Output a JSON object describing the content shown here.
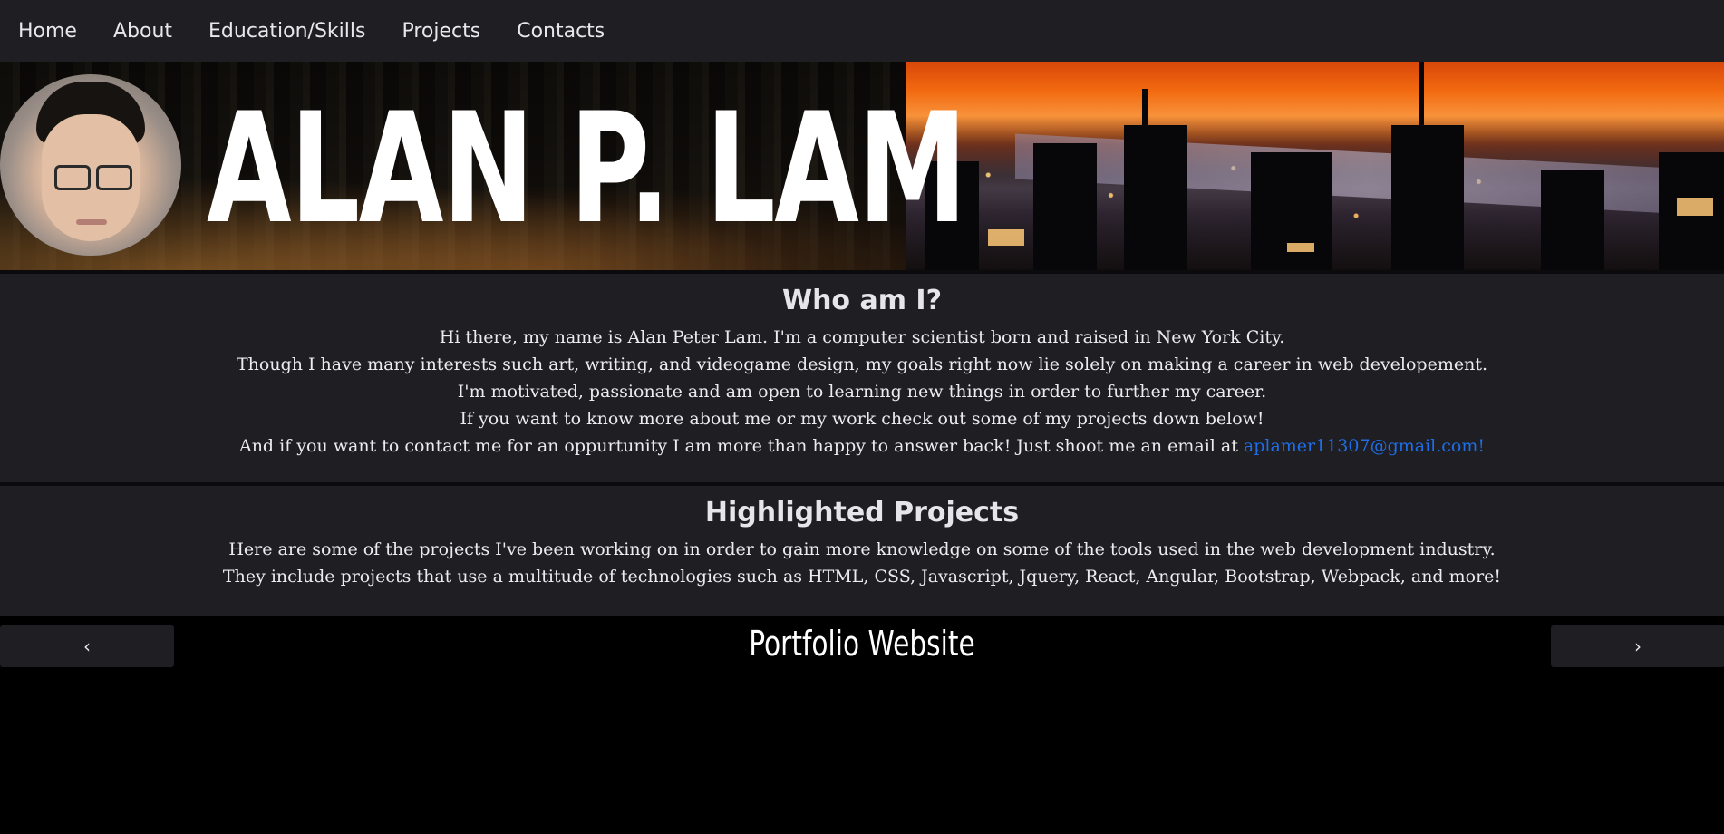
{
  "nav": {
    "items": [
      {
        "label": "Home"
      },
      {
        "label": "About"
      },
      {
        "label": "Education/Skills"
      },
      {
        "label": "Projects"
      },
      {
        "label": "Contacts"
      }
    ]
  },
  "banner": {
    "name": "ALAN P. LAM"
  },
  "about": {
    "title": "Who am I?",
    "lines": [
      "Hi there, my name is Alan Peter Lam. I'm a computer scientist born and raised in New York City.",
      "Though I have many interests such art, writing, and videogame design, my goals right now lie solely on making a career in web developement.",
      "I'm motivated, passionate and am open to learning new things in order to further my career.",
      "If you want to know more about me or my work check out some of my projects down below!",
      "And if you want to contact me for an oppurtunity I am more than happy to answer back! Just shoot me an email at "
    ],
    "email": "aplamer11307@gmail.com!"
  },
  "projects": {
    "title": "Highlighted Projects",
    "lines": [
      "Here are some of the projects I've been working on in order to gain more knowledge on some of the tools used in the web development industry.",
      "They include projects that use a multitude of technologies such as HTML, CSS, Javascript, Jquery, React, Angular, Bootstrap, Webpack, and more!"
    ]
  },
  "carousel": {
    "prev_label": "‹",
    "next_label": "›",
    "current_title": "Portfolio Website"
  },
  "colors": {
    "nav_bg": "#1e1e23",
    "section_bg": "#1e1e23",
    "link": "#1e6ee8",
    "page_bg": "#000000"
  }
}
